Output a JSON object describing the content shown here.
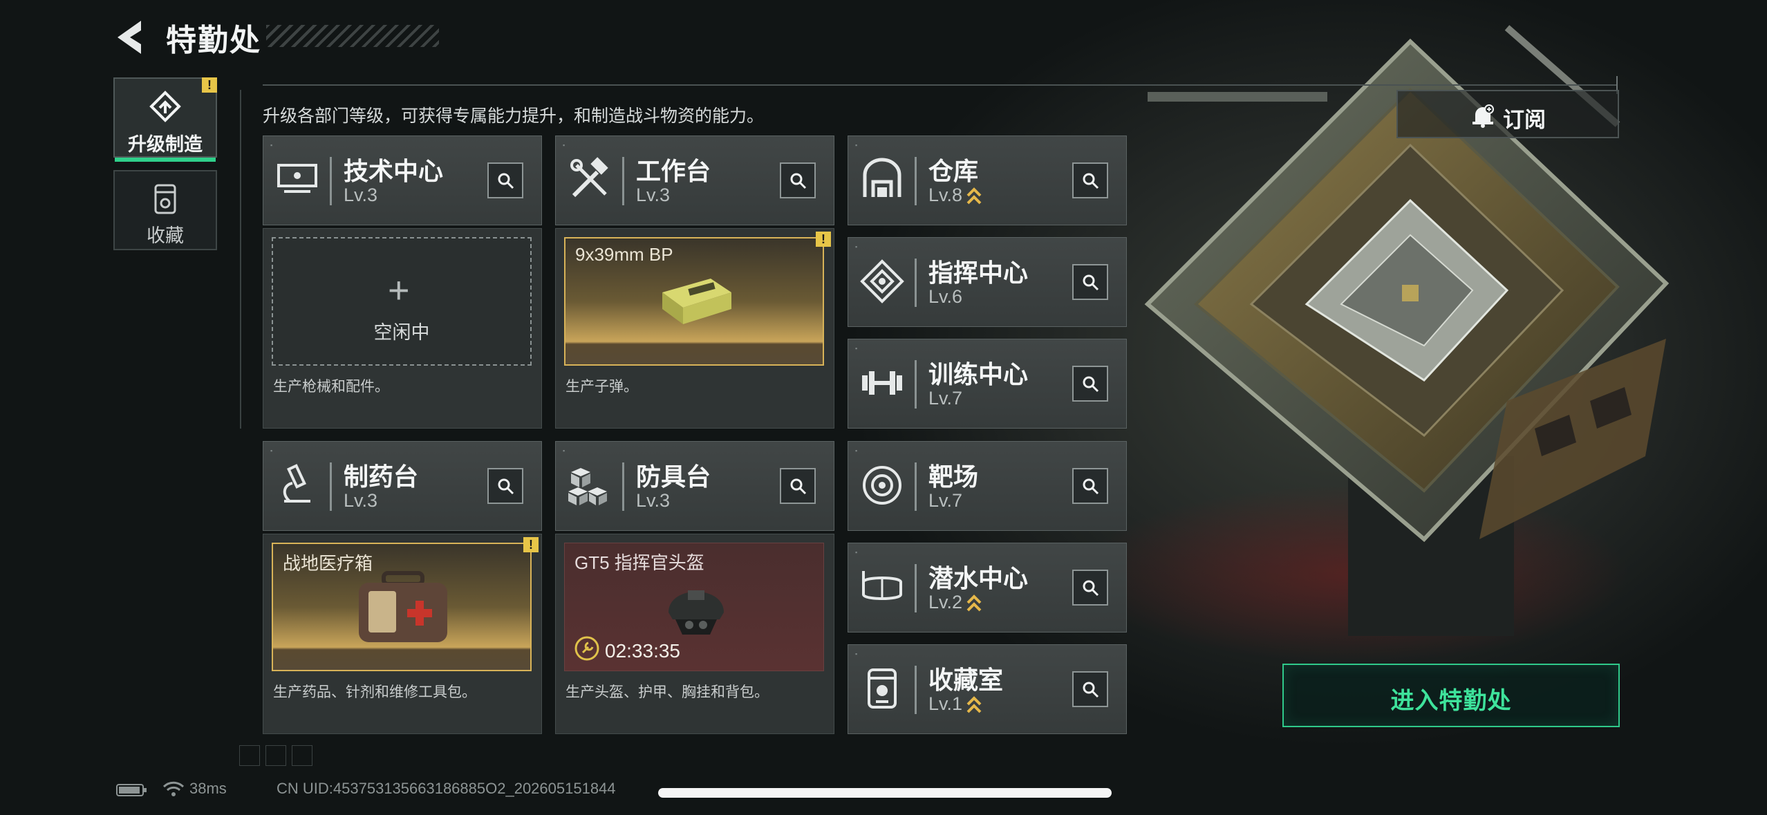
{
  "header": {
    "title": "特勤处",
    "subtitle": "升级各部门等级，可获得专属能力提升，和制造战斗物资的能力。"
  },
  "side_tabs": [
    {
      "label": "升级制造",
      "active": true,
      "alert": "!"
    },
    {
      "label": "收藏",
      "active": false
    }
  ],
  "departments": {
    "tech": {
      "name": "技术中心",
      "level": "Lv.3",
      "desc": "生产枪械和配件。",
      "slot_state": "空闲中",
      "slot_plus": "+"
    },
    "workbench": {
      "name": "工作台",
      "level": "Lv.3",
      "desc": "生产子弹。",
      "item": "9x39mm BP",
      "alert": "!"
    },
    "pharmacy": {
      "name": "制药台",
      "level": "Lv.3",
      "desc": "生产药品、针剂和维修工具包。",
      "item": "战地医疗箱",
      "alert": "!"
    },
    "armor": {
      "name": "防具台",
      "level": "Lv.3",
      "desc": "生产头盔、护甲、胸挂和背包。",
      "item": "GT5 指挥官头盔",
      "timer": "02:33:35"
    },
    "warehouse": {
      "name": "仓库",
      "level": "Lv.8",
      "upgradable": true
    },
    "command": {
      "name": "指挥中心",
      "level": "Lv.6"
    },
    "training": {
      "name": "训练中心",
      "level": "Lv.7"
    },
    "range": {
      "name": "靶场",
      "level": "Lv.7"
    },
    "diving": {
      "name": "潜水中心",
      "level": "Lv.2",
      "upgradable": true
    },
    "collection": {
      "name": "收藏室",
      "level": "Lv.1",
      "upgradable": true
    }
  },
  "buttons": {
    "subscribe": "订阅",
    "enter": "进入特勤处"
  },
  "status_bar": {
    "ping": "38ms",
    "uid": "CN UID:453753135663186885O2_202605151844"
  },
  "colors": {
    "accent_green": "#3ee39b",
    "alert_yellow": "#e7c548",
    "upgrade_gold": "#e6b84a"
  }
}
